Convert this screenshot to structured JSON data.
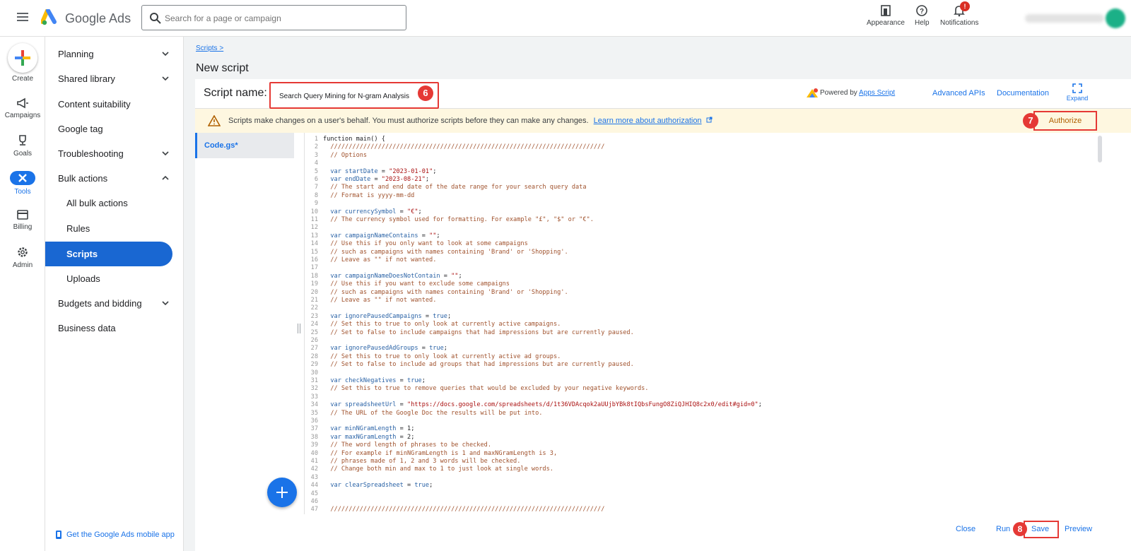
{
  "app": {
    "title": "Google Ads"
  },
  "search": {
    "placeholder": "Search for a page or campaign"
  },
  "top_tools": {
    "appearance": "Appearance",
    "help": "Help",
    "notifications": "Notifications",
    "notification_badge": "!"
  },
  "rail": {
    "create": "Create",
    "campaigns": "Campaigns",
    "goals": "Goals",
    "tools": "Tools",
    "billing": "Billing",
    "admin": "Admin"
  },
  "nav": {
    "items": [
      {
        "label": "Planning",
        "chevron": "down"
      },
      {
        "label": "Shared library",
        "chevron": "down"
      },
      {
        "label": "Content suitability"
      },
      {
        "label": "Google tag"
      },
      {
        "label": "Troubleshooting",
        "chevron": "down"
      },
      {
        "label": "Bulk actions",
        "chevron": "up"
      },
      {
        "label": "All bulk actions"
      },
      {
        "label": "Rules"
      },
      {
        "label": "Scripts",
        "active": true
      },
      {
        "label": "Uploads"
      },
      {
        "label": "Budgets and bidding",
        "chevron": "down"
      },
      {
        "label": "Business data"
      }
    ],
    "mobile_app": "Get the Google Ads mobile app"
  },
  "breadcrumb": "Scripts >",
  "page_title": "New script",
  "script": {
    "name_label": "Script name:",
    "name_value": "Search Query Mining for N-gram Analysis",
    "powered_by": "Powered by",
    "apps_script": "Apps Script",
    "advanced_apis": "Advanced APIs",
    "documentation": "Documentation",
    "expand": "Expand"
  },
  "warning": {
    "text": "Scripts make changes on a user's behalf. You must authorize scripts before they can make any changes.",
    "link": "Learn more about authorization",
    "authorize": "Authorize"
  },
  "file_tab": "Code.gs*",
  "steps": {
    "s6": "6",
    "s7": "7",
    "s8": "8"
  },
  "code": [
    [
      [
        "pl",
        "function main() {"
      ]
    ],
    [
      [
        "cm",
        "  ///////////////////////////////////////////////////////////////////////////"
      ]
    ],
    [
      [
        "cm",
        "  // Options"
      ]
    ],
    [],
    [
      [
        "kw",
        "  var "
      ],
      [
        "vn",
        "startDate"
      ],
      [
        "pl",
        " = "
      ],
      [
        "st",
        "\"2023-01-01\""
      ],
      [
        "pl",
        ";"
      ]
    ],
    [
      [
        "kw",
        "  var "
      ],
      [
        "vn",
        "endDate"
      ],
      [
        "pl",
        " = "
      ],
      [
        "st",
        "\"2023-08-21\""
      ],
      [
        "pl",
        ";"
      ]
    ],
    [
      [
        "cm",
        "  // The start and end date of the date range for your search query data"
      ]
    ],
    [
      [
        "cm",
        "  // Format is yyyy-mm-dd"
      ]
    ],
    [],
    [
      [
        "kw",
        "  var "
      ],
      [
        "vn",
        "currencySymbol"
      ],
      [
        "pl",
        " = "
      ],
      [
        "st",
        "\"€\""
      ],
      [
        "pl",
        ";"
      ]
    ],
    [
      [
        "cm",
        "  // The currency symbol used for formatting. For example \"£\", \"$\" or \"€\"."
      ]
    ],
    [],
    [
      [
        "kw",
        "  var "
      ],
      [
        "vn",
        "campaignNameContains"
      ],
      [
        "pl",
        " = "
      ],
      [
        "st",
        "\"\""
      ],
      [
        "pl",
        ";"
      ]
    ],
    [
      [
        "cm",
        "  // Use this if you only want to look at some campaigns"
      ]
    ],
    [
      [
        "cm",
        "  // such as campaigns with names containing 'Brand' or 'Shopping'."
      ]
    ],
    [
      [
        "cm",
        "  // Leave as \"\" if not wanted."
      ]
    ],
    [],
    [
      [
        "kw",
        "  var "
      ],
      [
        "vn",
        "campaignNameDoesNotContain"
      ],
      [
        "pl",
        " = "
      ],
      [
        "st",
        "\"\""
      ],
      [
        "pl",
        ";"
      ]
    ],
    [
      [
        "cm",
        "  // Use this if you want to exclude some campaigns"
      ]
    ],
    [
      [
        "cm",
        "  // such as campaigns with names containing 'Brand' or 'Shopping'."
      ]
    ],
    [
      [
        "cm",
        "  // Leave as \"\" if not wanted."
      ]
    ],
    [],
    [
      [
        "kw",
        "  var "
      ],
      [
        "vn",
        "ignorePausedCampaigns"
      ],
      [
        "pl",
        " = "
      ],
      [
        "kw",
        "true"
      ],
      [
        "pl",
        ";"
      ]
    ],
    [
      [
        "cm",
        "  // Set this to true to only look at currently active campaigns."
      ]
    ],
    [
      [
        "cm",
        "  // Set to false to include campaigns that had impressions but are currently paused."
      ]
    ],
    [],
    [
      [
        "kw",
        "  var "
      ],
      [
        "vn",
        "ignorePausedAdGroups"
      ],
      [
        "pl",
        " = "
      ],
      [
        "kw",
        "true"
      ],
      [
        "pl",
        ";"
      ]
    ],
    [
      [
        "cm",
        "  // Set this to true to only look at currently active ad groups."
      ]
    ],
    [
      [
        "cm",
        "  // Set to false to include ad groups that had impressions but are currently paused."
      ]
    ],
    [],
    [
      [
        "kw",
        "  var "
      ],
      [
        "vn",
        "checkNegatives"
      ],
      [
        "pl",
        " = "
      ],
      [
        "kw",
        "true"
      ],
      [
        "pl",
        ";"
      ]
    ],
    [
      [
        "cm",
        "  // Set this to true to remove queries that would be excluded by your negative keywords."
      ]
    ],
    [],
    [
      [
        "kw",
        "  var "
      ],
      [
        "vn",
        "spreadsheetUrl"
      ],
      [
        "pl",
        " = "
      ],
      [
        "st",
        "\"https://docs.google.com/spreadsheets/d/1t36VDAcqok2aUUjbYBk8tIQbsFungO8ZiQJHIQ8c2x0/edit#gid=0\""
      ],
      [
        "pl",
        ";"
      ]
    ],
    [
      [
        "cm",
        "  // The URL of the Google Doc the results will be put into."
      ]
    ],
    [],
    [
      [
        "kw",
        "  var "
      ],
      [
        "vn",
        "minNGramLength"
      ],
      [
        "pl",
        " = "
      ],
      [
        "pl",
        "1"
      ],
      [
        "pl",
        ";"
      ]
    ],
    [
      [
        "kw",
        "  var "
      ],
      [
        "vn",
        "maxNGramLength"
      ],
      [
        "pl",
        " = "
      ],
      [
        "pl",
        "2"
      ],
      [
        "pl",
        ";"
      ]
    ],
    [
      [
        "cm",
        "  // The word length of phrases to be checked."
      ]
    ],
    [
      [
        "cm",
        "  // For example if minNGramLength is 1 and maxNGramLength is 3,"
      ]
    ],
    [
      [
        "cm",
        "  // phrases made of 1, 2 and 3 words will be checked."
      ]
    ],
    [
      [
        "cm",
        "  // Change both min and max to 1 to just look at single words."
      ]
    ],
    [],
    [
      [
        "kw",
        "  var "
      ],
      [
        "vn",
        "clearSpreadsheet"
      ],
      [
        "pl",
        " = "
      ],
      [
        "kw",
        "true"
      ],
      [
        "pl",
        ";"
      ]
    ],
    [],
    [],
    [
      [
        "cm",
        "  ///////////////////////////////////////////////////////////////////////////"
      ]
    ]
  ],
  "footer": {
    "close": "Close",
    "run": "Run",
    "save": "Save",
    "preview": "Preview"
  },
  "colors": {
    "accent": "#1a73e8",
    "highlight": "#e53935",
    "warning_bg": "#fef7e0"
  }
}
